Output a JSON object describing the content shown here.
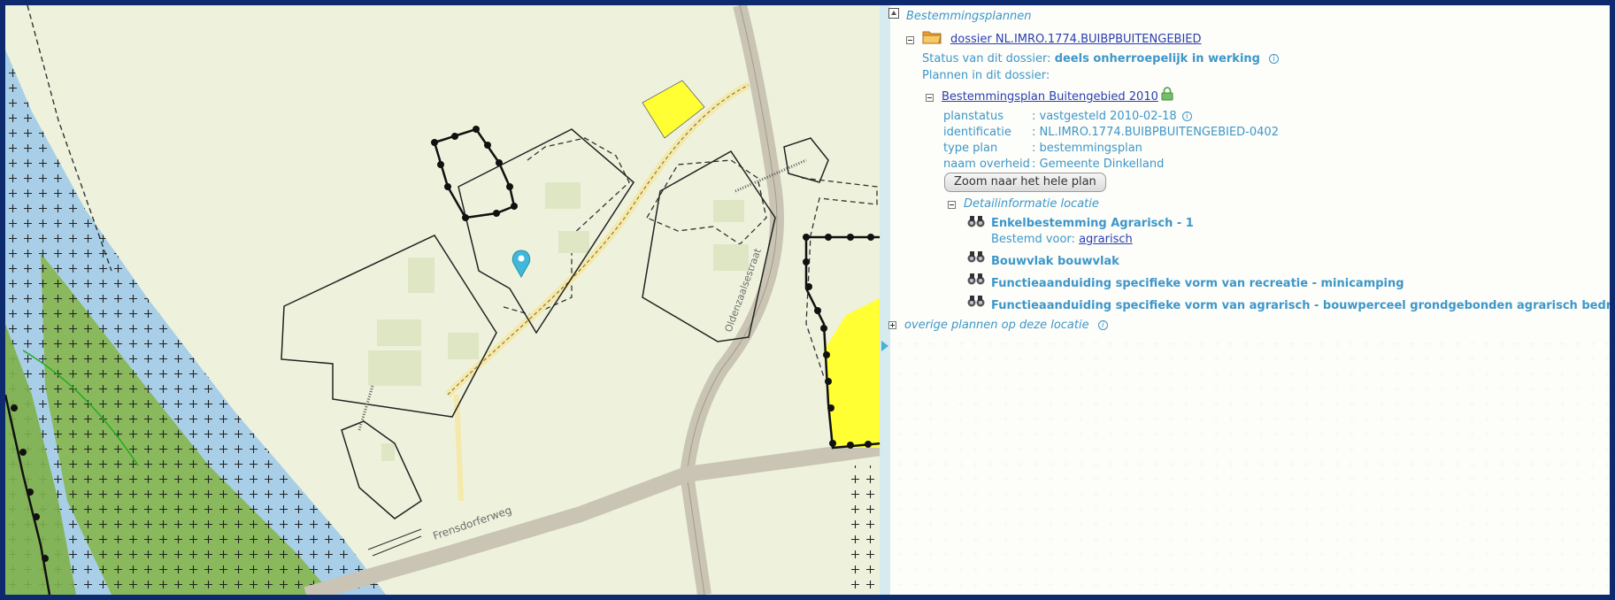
{
  "map": {
    "road_label_1": "Frensdorferweg",
    "road_label_2": "Oldenzaalsestraat"
  },
  "panel": {
    "root_label": "Bestemmingsplannen",
    "dossier_link": "dossier NL.IMRO.1774.BUIBPBUITENGEBIED",
    "status_label": "Status van dit dossier:",
    "status_value": "deels onherroepelijk in werking",
    "plans_label": "Plannen in dit dossier:",
    "plan_link": "Bestemmingsplan Buitengebied 2010",
    "meta": [
      {
        "key": "planstatus",
        "value": ": vastgesteld 2010-02-18"
      },
      {
        "key": "identificatie",
        "value": ": NL.IMRO.1774.BUIBPBUITENGEBIED-0402"
      },
      {
        "key": "type plan",
        "value": ": bestemmingsplan"
      },
      {
        "key": "naam overheid",
        "value": ": Gemeente Dinkelland"
      }
    ],
    "zoom_button": "Zoom naar het hele plan",
    "detail_label": "Detailinformatie locatie",
    "items": [
      {
        "label": "Enkelbestemming Agrarisch - 1"
      },
      {
        "label": "Bouwvlak bouwvlak"
      },
      {
        "label": "Functieaanduiding specifieke vorm van recreatie - minicamping"
      },
      {
        "label": "Functieaanduiding specifieke vorm van agrarisch - bouwperceel grondgebonden agrarisch bedrijf"
      }
    ],
    "bestemd_label": "Bestemd voor:",
    "bestemd_link": "agrarisch",
    "other_plans": "overige plannen op deze locatie",
    "info_glyph": "i"
  },
  "colors": {
    "border": "#0e2a6e",
    "map_base": "#eef2dc",
    "water_blue": "#a9cfe8",
    "green": "#86b64e",
    "yellow": "#ffff33",
    "road": "#c9c4b4",
    "panel_text": "#3d97c9",
    "link": "#2a3fb0"
  }
}
